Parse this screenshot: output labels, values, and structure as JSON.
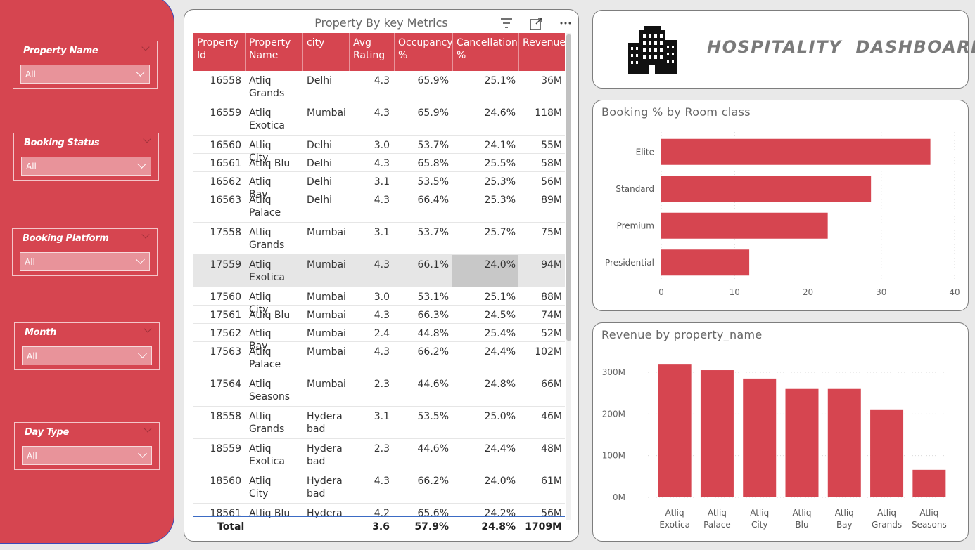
{
  "slicers": [
    {
      "title": "Property Name",
      "value": "All"
    },
    {
      "title": "Booking Status",
      "value": "All"
    },
    {
      "title": "Booking Platform",
      "value": "All"
    },
    {
      "title": "Month",
      "value": "All"
    },
    {
      "title": "Day Type",
      "value": "All"
    }
  ],
  "table": {
    "title": "Property By key Metrics",
    "headers": [
      "Property Id",
      "Property Name",
      "city",
      "Avg Rating",
      "Occupancy %",
      "Cancellation %",
      "Revenue"
    ],
    "rows": [
      [
        "16558",
        "Atliq Grands",
        "Delhi",
        "4.3",
        "65.9%",
        "25.1%",
        "36M"
      ],
      [
        "16559",
        "Atliq Exotica",
        "Mumbai",
        "4.3",
        "65.9%",
        "24.6%",
        "118M"
      ],
      [
        "16560",
        "Atliq City",
        "Delhi",
        "3.0",
        "53.7%",
        "24.1%",
        "55M"
      ],
      [
        "16561",
        "Atliq Blu",
        "Delhi",
        "4.3",
        "65.8%",
        "25.5%",
        "58M"
      ],
      [
        "16562",
        "Atliq Bay",
        "Delhi",
        "3.1",
        "53.5%",
        "25.3%",
        "56M"
      ],
      [
        "16563",
        "Atliq Palace",
        "Delhi",
        "4.3",
        "66.4%",
        "25.3%",
        "89M"
      ],
      [
        "17558",
        "Atliq Grands",
        "Mumbai",
        "3.1",
        "53.7%",
        "25.7%",
        "75M"
      ],
      [
        "17559",
        "Atliq Exotica",
        "Mumbai",
        "4.3",
        "66.1%",
        "24.0%",
        "94M"
      ],
      [
        "17560",
        "Atliq City",
        "Mumbai",
        "3.0",
        "53.1%",
        "25.1%",
        "88M"
      ],
      [
        "17561",
        "Atliq Blu",
        "Mumbai",
        "4.3",
        "66.3%",
        "24.5%",
        "74M"
      ],
      [
        "17562",
        "Atliq Bay",
        "Mumbai",
        "2.4",
        "44.8%",
        "25.4%",
        "52M"
      ],
      [
        "17563",
        "Atliq Palace",
        "Mumbai",
        "4.3",
        "66.2%",
        "24.4%",
        "102M"
      ],
      [
        "17564",
        "Atliq Seasons",
        "Mumbai",
        "2.3",
        "44.6%",
        "24.8%",
        "66M"
      ],
      [
        "18558",
        "Atliq Grands",
        "Hyderabad",
        "3.1",
        "53.5%",
        "25.0%",
        "46M"
      ],
      [
        "18559",
        "Atliq Exotica",
        "Hyderabad",
        "2.3",
        "44.6%",
        "24.4%",
        "48M"
      ],
      [
        "18560",
        "Atliq City",
        "Hyderabad",
        "4.3",
        "66.2%",
        "24.0%",
        "61M"
      ],
      [
        "18561",
        "Atliq Blu",
        "Hyderab",
        "4.2",
        "65.6%",
        "24.2%",
        "56M"
      ]
    ],
    "total": {
      "label": "Total",
      "avg_rating": "3.6",
      "occupancy": "57.9%",
      "cancellation": "24.8%",
      "revenue": "1709M"
    }
  },
  "header": {
    "title": "HOSPITALITY  DASHBOARD"
  },
  "colors": {
    "accent": "#d64550",
    "background": "#e9e9e9"
  },
  "chart_data": [
    {
      "type": "bar",
      "orientation": "horizontal",
      "title": "Booking % by Room class",
      "categories": [
        "Elite",
        "Standard",
        "Premium",
        "Presidential"
      ],
      "values": [
        36.7,
        28.6,
        22.7,
        12.0
      ],
      "xlim": [
        0,
        40
      ],
      "xticks": [
        "0",
        "10",
        "20",
        "30",
        "40"
      ],
      "grid": true
    },
    {
      "type": "bar",
      "title": "Revenue by property_name",
      "categories": [
        "Atliq Exotica",
        "Atliq Palace",
        "Atliq City",
        "Atliq Blu",
        "Atliq Bay",
        "Atliq Grands",
        "Atliq Seasons"
      ],
      "values": [
        320,
        305,
        285,
        260,
        260,
        211,
        66
      ],
      "ylim": [
        0,
        300
      ],
      "yticks": [
        "0M",
        "100M",
        "200M",
        "300M"
      ],
      "grid": true
    }
  ]
}
